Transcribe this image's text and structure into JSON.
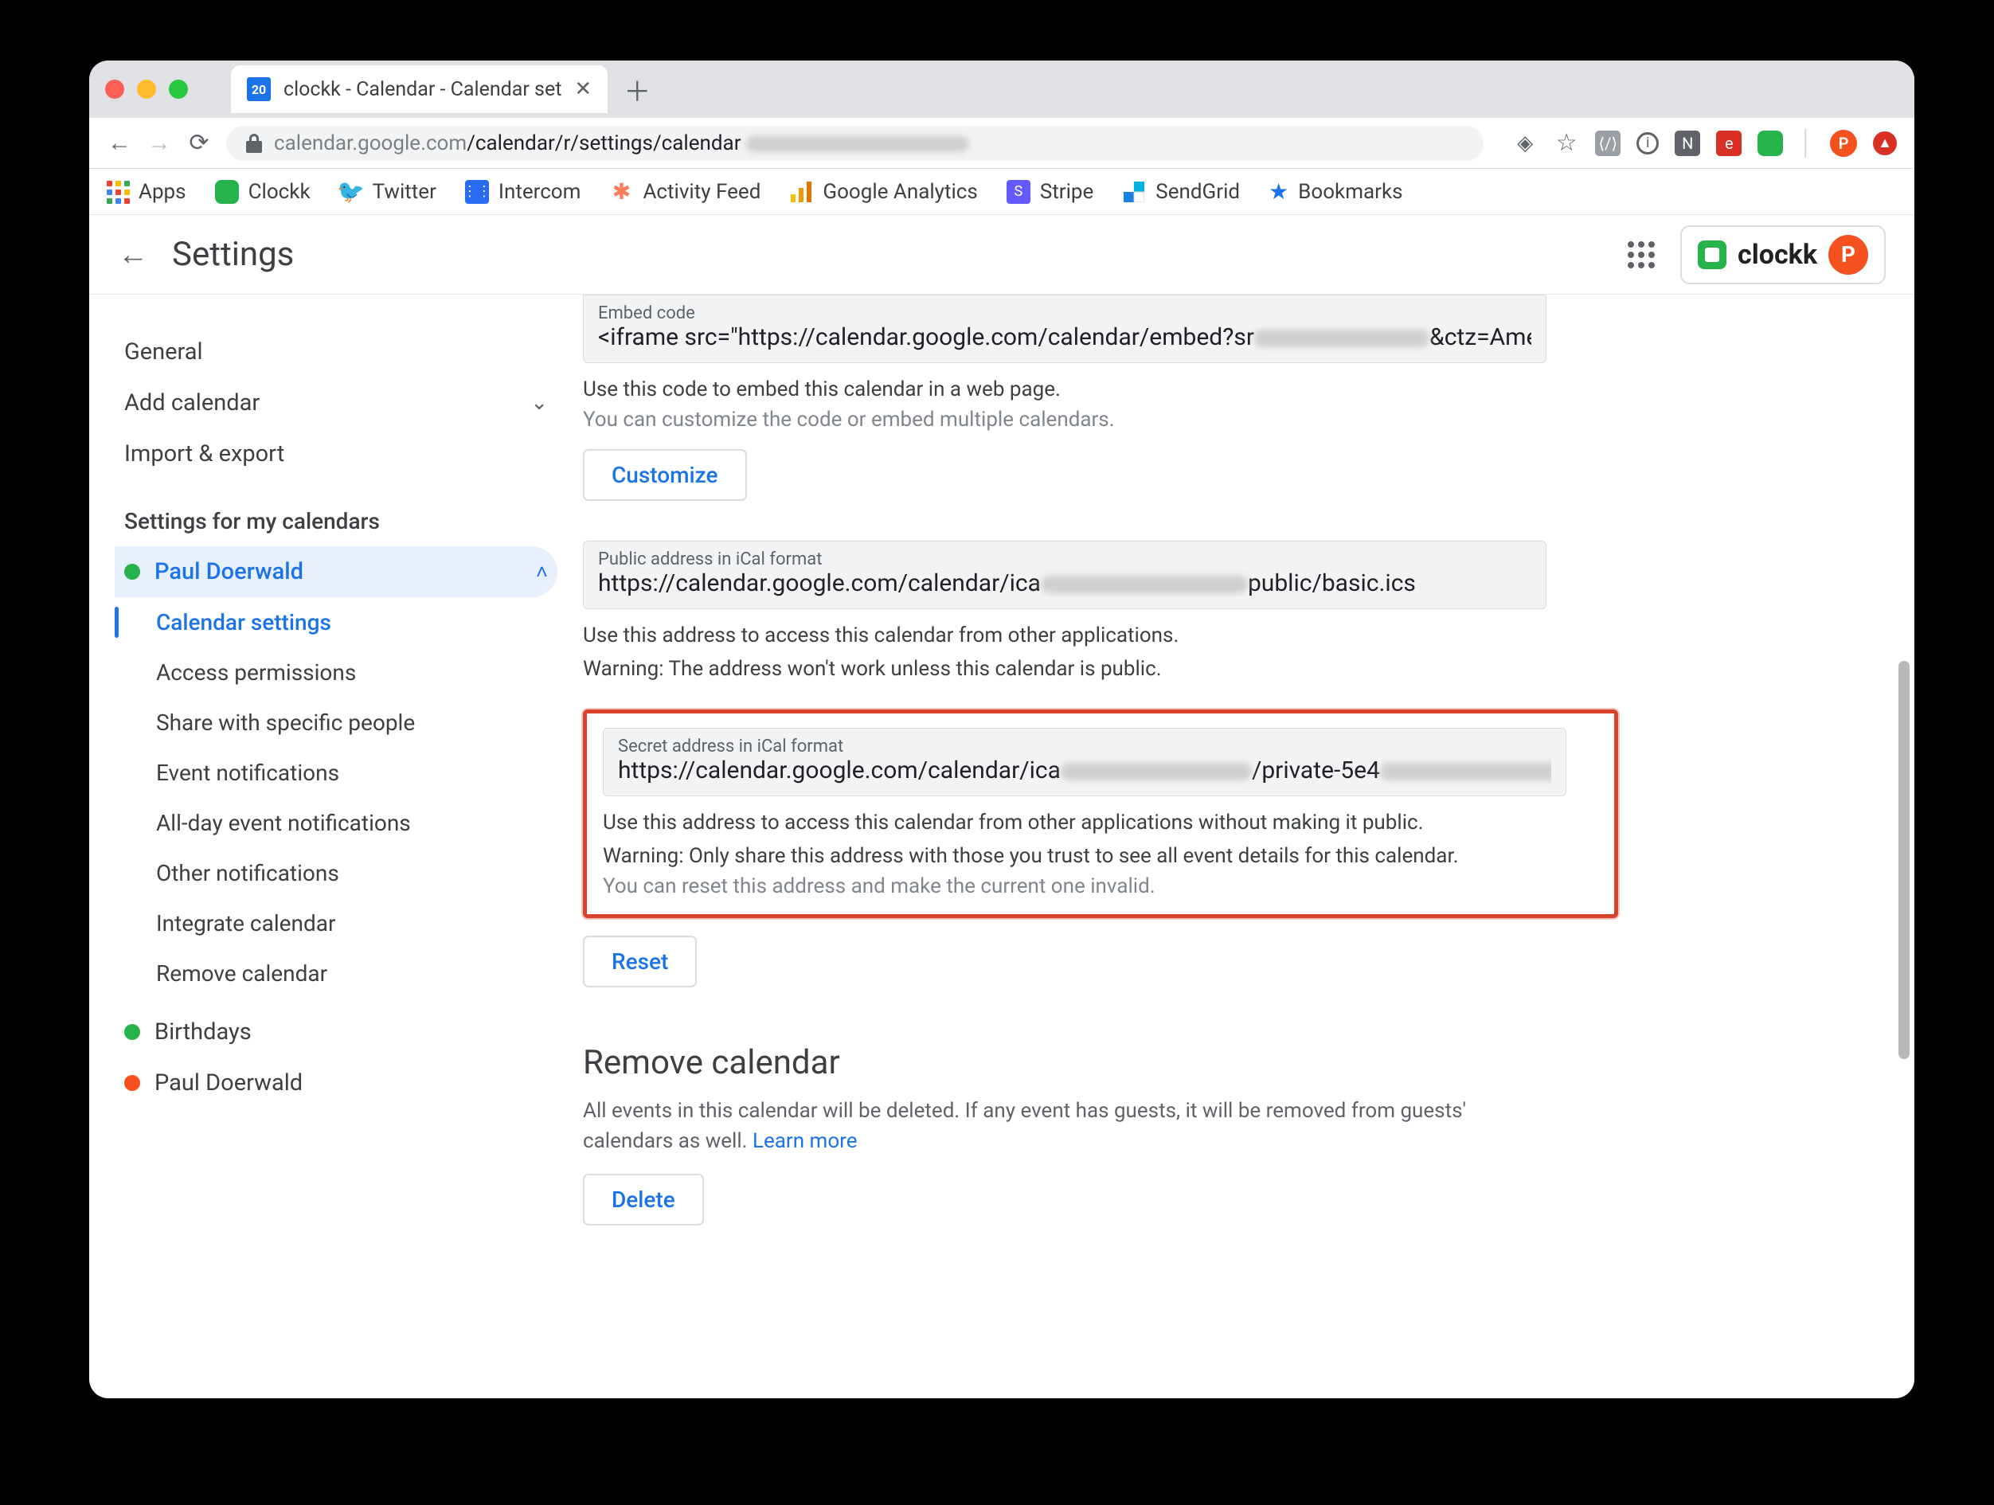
{
  "tab": {
    "title": "clockk - Calendar - Calendar set",
    "favicon_badge": "20"
  },
  "url": {
    "host": "calendar.google.com",
    "path": "/calendar/r/settings/calendar"
  },
  "bookmarks": [
    {
      "label": "Apps"
    },
    {
      "label": "Clockk"
    },
    {
      "label": "Twitter"
    },
    {
      "label": "Intercom"
    },
    {
      "label": "Activity Feed"
    },
    {
      "label": "Google Analytics"
    },
    {
      "label": "Stripe"
    },
    {
      "label": "SendGrid"
    },
    {
      "label": "Bookmarks"
    }
  ],
  "header": {
    "title": "Settings",
    "brand": "clockk",
    "avatar_initial": "P"
  },
  "sidebar": {
    "items": [
      {
        "label": "General"
      },
      {
        "label": "Add calendar"
      },
      {
        "label": "Import & export"
      }
    ],
    "heading": "Settings for my calendars",
    "selected_cal": "Paul Doerwald",
    "subitems": [
      {
        "label": "Calendar settings"
      },
      {
        "label": "Access permissions"
      },
      {
        "label": "Share with specific people"
      },
      {
        "label": "Event notifications"
      },
      {
        "label": "All-day event notifications"
      },
      {
        "label": "Other notifications"
      },
      {
        "label": "Integrate calendar"
      },
      {
        "label": "Remove calendar"
      }
    ],
    "other_cals": [
      {
        "label": "Birthdays",
        "color": "#26b34b"
      },
      {
        "label": "Paul Doerwald",
        "color": "#f4511e"
      }
    ]
  },
  "main": {
    "embed": {
      "label": "Embed code",
      "value_prefix": "<iframe src=\"https://calendar.google.com/calendar/embed?sr",
      "value_suffix": "&ctz=Amer",
      "help": "Use this code to embed this calendar in a web page.",
      "help2": "You can customize the code or embed multiple calendars.",
      "button": "Customize"
    },
    "public_ical": {
      "label": "Public address in iCal format",
      "value_prefix": "https://calendar.google.com/calendar/ica",
      "value_suffix": "public/basic.ics",
      "help": "Use this address to access this calendar from other applications.",
      "warning": "Warning: The address won't work unless this calendar is public."
    },
    "secret_ical": {
      "label": "Secret address in iCal format",
      "value_prefix": "https://calendar.google.com/calendar/ica",
      "value_mid": "/private-5e4",
      "help": "Use this address to access this calendar from other applications without making it public.",
      "warning": "Warning: Only share this address with those you trust to see all event details for this calendar.",
      "note": "You can reset this address and make the current one invalid.",
      "button": "Reset"
    },
    "remove": {
      "title": "Remove calendar",
      "body": "All events in this calendar will be deleted. If any event has guests, it will be removed from guests' calendars as well. ",
      "learn_more": "Learn more",
      "button": "Delete"
    }
  }
}
